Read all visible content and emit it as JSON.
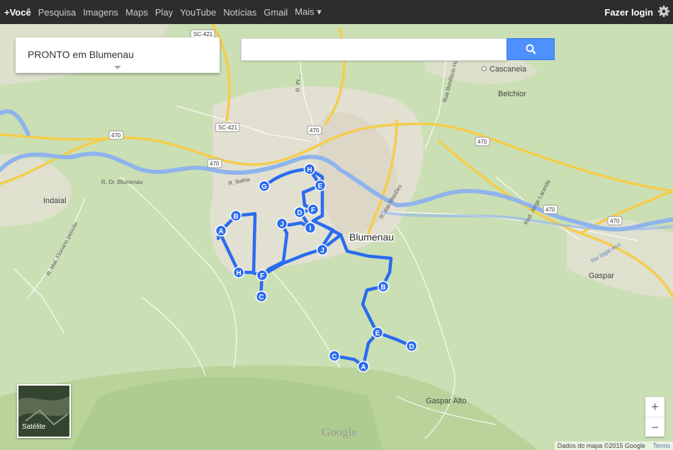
{
  "topbar": {
    "links": [
      "+Você",
      "Pesquisa",
      "Imagens",
      "Maps",
      "Play",
      "YouTube",
      "Notícias",
      "Gmail",
      "Mais ▾"
    ],
    "login": "Fazer login",
    "settings_icon": "gear-icon"
  },
  "title_card": {
    "text": "PRONTO em Blumenau"
  },
  "search": {
    "value": "",
    "icon": "search-icon"
  },
  "places": {
    "cascaneia": "Cascaneia",
    "belchior": "Belchior",
    "indaial": "Indaial",
    "blumenau": "Blumenau",
    "gaspar": "Gaspar",
    "gaspar_alto": "Gaspar Alto"
  },
  "roads": {
    "sc421_a": "SC-421",
    "sc421_b": "SC-421",
    "r470_1": "470",
    "r470_2": "470",
    "r470_3": "470",
    "r470_4": "470",
    "r470_5": "470",
    "r470_6": "470",
    "rdr_blumenau": "R. Dr. Blumenau",
    "rbahia": "R. Bahia",
    "rfloriano": "R. Mal. Floriano peixoto",
    "rmissoes": "R. das Missões",
    "jorge_lacerda": "Rod. Jorge Lacerda",
    "rio_itajai": "Rio Itajaí-Açu",
    "rbonifacio": "Rua Bonifácio Ha...",
    "ponta": "R. Pr..."
  },
  "routes": {
    "west_markers": [
      "A",
      "B",
      "C",
      "D",
      "E",
      "F",
      "G",
      "H",
      "I",
      "J"
    ],
    "east_markers": [
      "A",
      "B",
      "C",
      "D",
      "E"
    ]
  },
  "controls": {
    "satellite": "Satélite",
    "zoom_in": "+",
    "zoom_out": "−"
  },
  "attribution": {
    "data": "Dados do mapa ©2015 Google",
    "terms": "Terms"
  },
  "watermark": "Google",
  "colors": {
    "route": "#2a6bf0",
    "water": "#8fb4ec",
    "highway": "#f5cd4a",
    "urban": "#e6e1d6"
  }
}
